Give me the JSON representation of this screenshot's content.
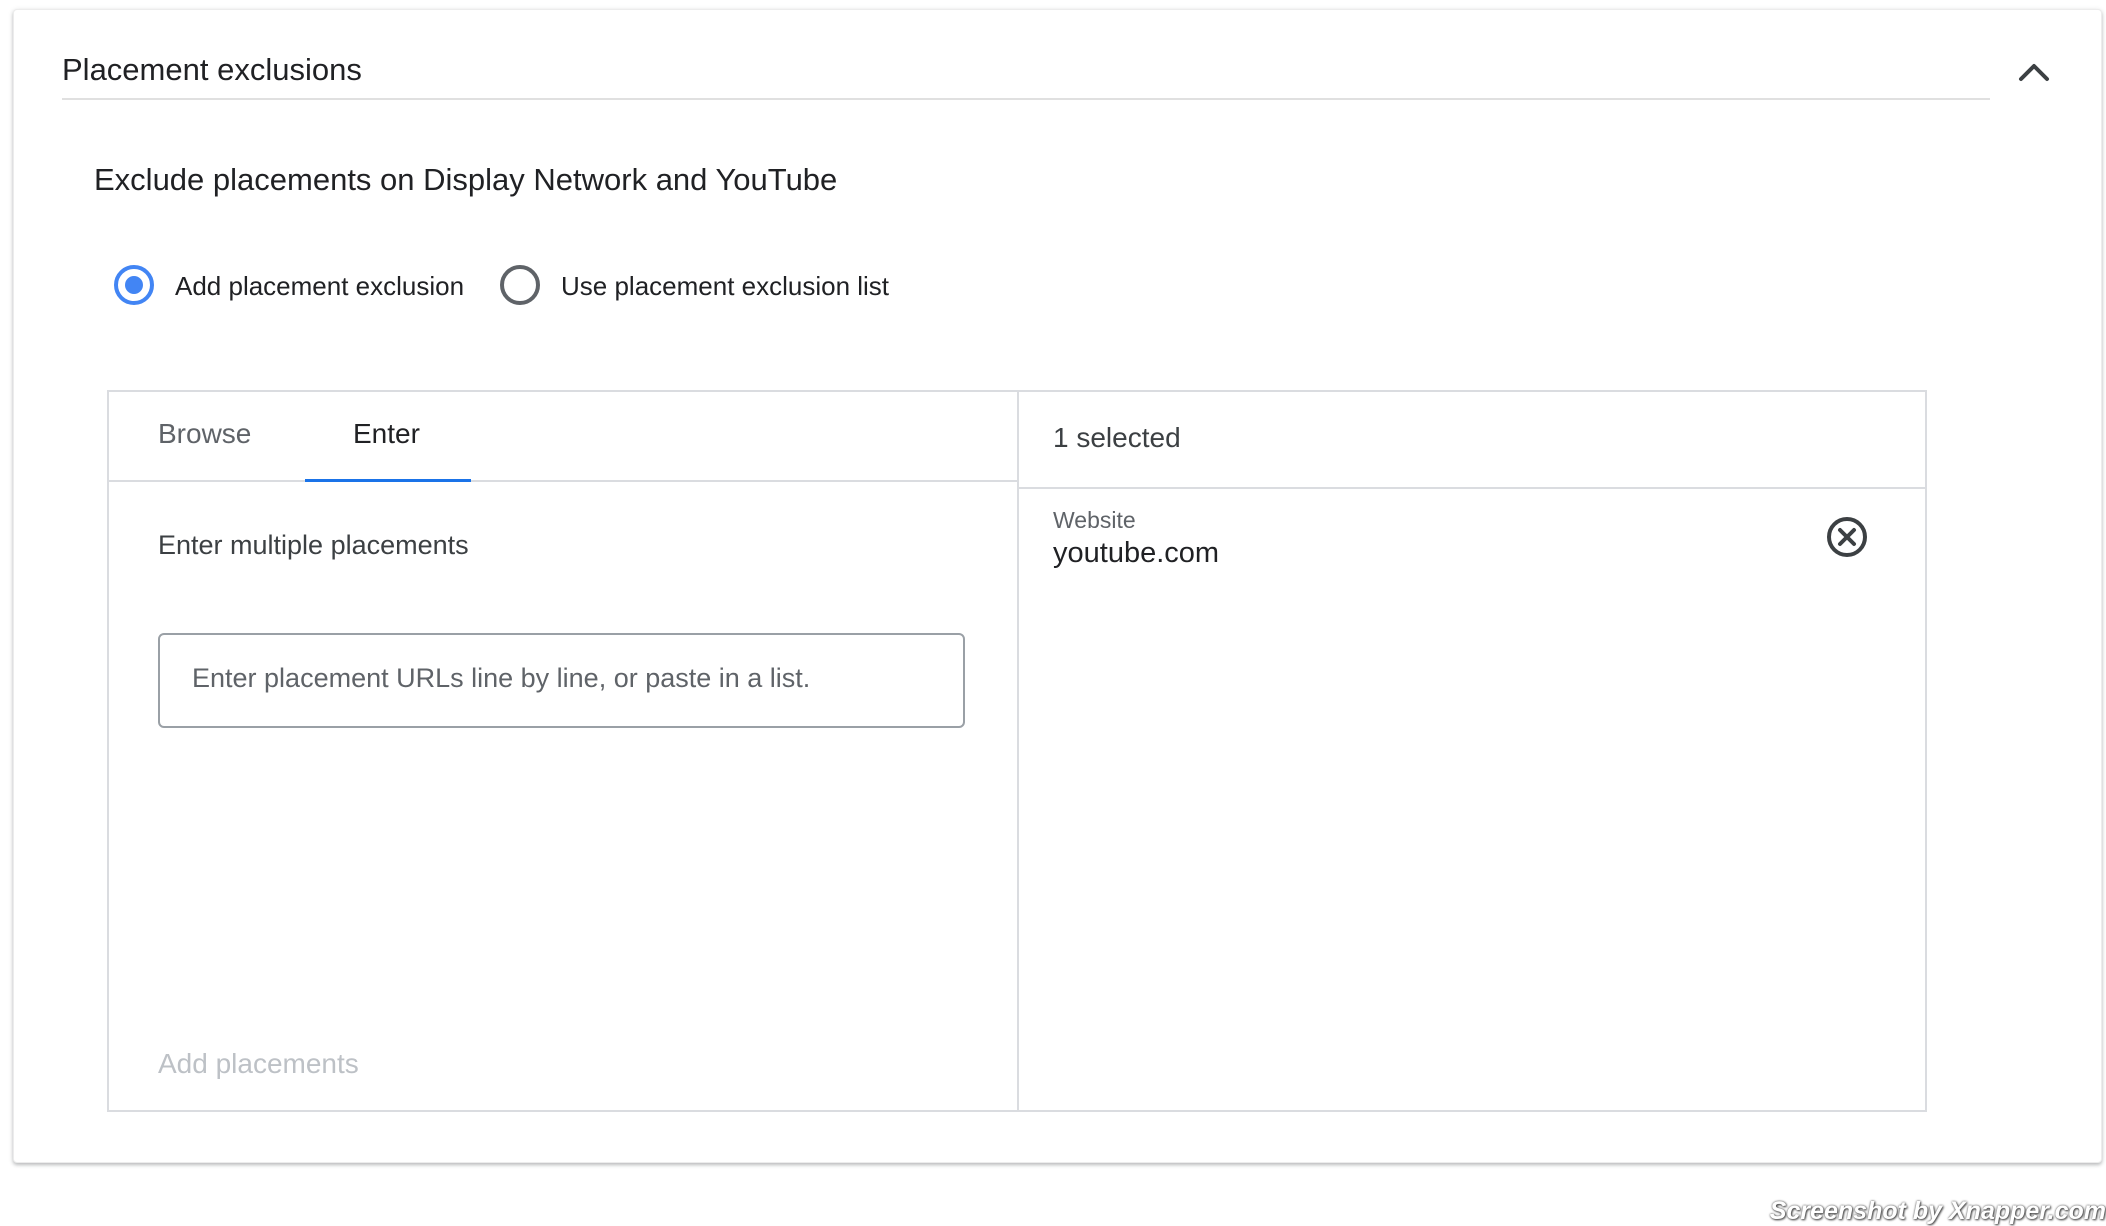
{
  "section": {
    "title": "Placement exclusions",
    "collapse_icon": "chevron-up-icon"
  },
  "subtitle": "Exclude placements on Display Network and YouTube",
  "radio_options": [
    {
      "label": "Add placement exclusion",
      "checked": true
    },
    {
      "label": "Use placement exclusion list",
      "checked": false
    }
  ],
  "tabs": [
    {
      "label": "Browse",
      "active": false
    },
    {
      "label": "Enter",
      "active": true
    }
  ],
  "enter_panel": {
    "label": "Enter multiple placements",
    "input_placeholder": "Enter placement URLs line by line, or paste in a list.",
    "input_value": "",
    "add_button": "Add placements"
  },
  "selected_panel": {
    "count_label": "1 selected",
    "items": [
      {
        "type": "Website",
        "value": "youtube.com",
        "remove_icon": "remove-circle-icon"
      }
    ]
  },
  "watermark": "Screenshot by Xnapper.com",
  "colors": {
    "accent": "#1a73e8",
    "radio_selected": "#4285f4",
    "disabled_text": "#bdc1c6",
    "border": "#dadce0"
  }
}
